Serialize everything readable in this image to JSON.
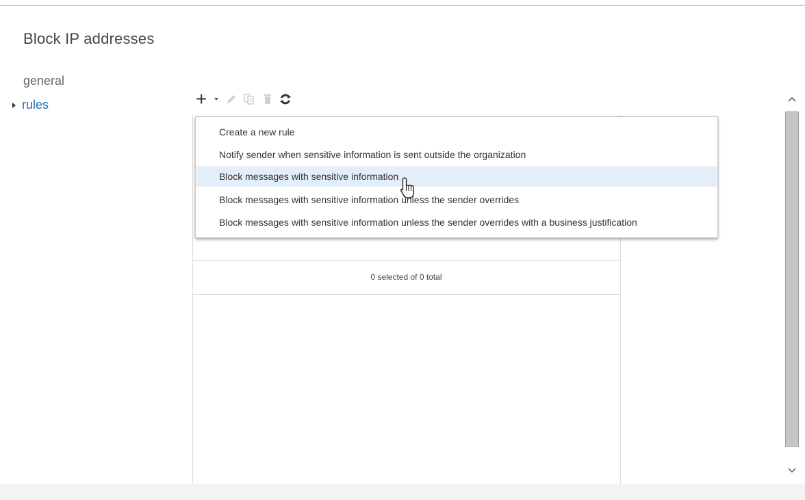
{
  "page": {
    "title": "Block IP addresses"
  },
  "nav": {
    "items": [
      {
        "label": "general"
      },
      {
        "label": "rules"
      }
    ]
  },
  "toolbar": {
    "icons": [
      "plus-icon",
      "dropdown-caret-icon",
      "edit-icon",
      "copy-icon",
      "delete-icon",
      "refresh-icon"
    ]
  },
  "new_rule_menu": {
    "items": [
      {
        "label": "Create a new rule"
      },
      {
        "label": "Notify sender when sensitive information is sent outside the organization"
      },
      {
        "label": "Block messages with sensitive information"
      },
      {
        "label": "Block messages with sensitive information unless the sender overrides"
      },
      {
        "label": "Block messages with sensitive information unless the sender overrides with a business justification"
      }
    ],
    "hovered_index": 2
  },
  "grid": {
    "status": "0 selected of 0 total"
  },
  "colors": {
    "link": "#1f6fb5",
    "hover": "#e4eef8",
    "scrollbar": "#c6c6c6"
  }
}
